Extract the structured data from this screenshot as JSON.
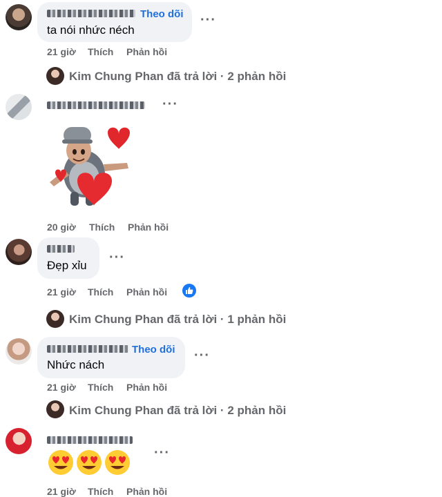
{
  "comments": [
    {
      "follow_label": "Theo dõi",
      "text": "ta nói nhức néch",
      "time": "21 giờ",
      "like_label": "Thích",
      "reply_label": "Phản hồi",
      "replies_summary": "Kim Chung Phan đã trả lời · 2 phản hồi"
    },
    {
      "time": "20 giờ",
      "like_label": "Thích",
      "reply_label": "Phản hồi"
    },
    {
      "text": "Đẹp xỉu",
      "time": "21 giờ",
      "like_label": "Thích",
      "reply_label": "Phản hồi",
      "replies_summary": "Kim Chung Phan đã trả lời · 1 phản hồi"
    },
    {
      "follow_label": "Theo dõi",
      "text": "Nhức nách",
      "time": "21 giờ",
      "like_label": "Thích",
      "reply_label": "Phản hồi",
      "replies_summary": "Kim Chung Phan đã trả lời · 2 phản hồi"
    },
    {
      "time": "21 giờ",
      "like_label": "Thích",
      "reply_label": "Phản hồi",
      "emoji_count": 3
    }
  ],
  "more_label": "···",
  "icons": {
    "like_reaction": "like-icon",
    "sticker": "heart-sticker-icon",
    "emoji": "heart-eyes-emoji-icon"
  },
  "colors": {
    "accent": "#216fdb",
    "bubble": "#f0f2f5",
    "meta": "#65676b",
    "like_badge": "#1877f2"
  }
}
